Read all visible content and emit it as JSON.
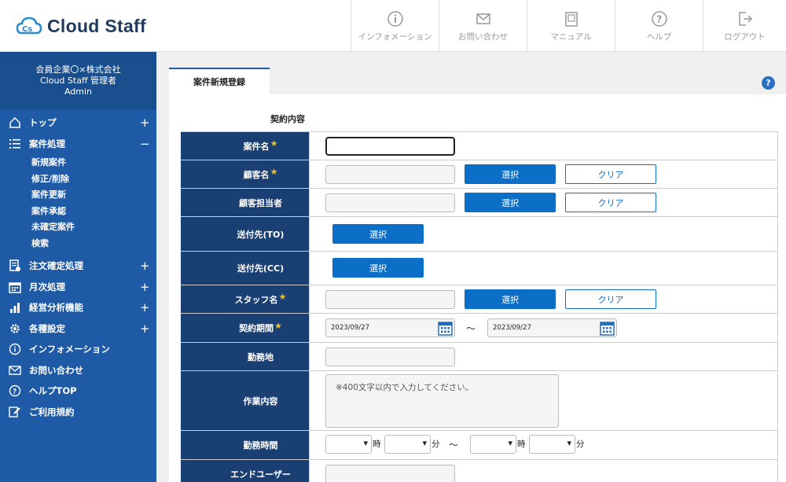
{
  "app": {
    "logo_text": "Cloud Staff",
    "brand_color": "#1e5aa6"
  },
  "header_nav": [
    {
      "label": "インフォメーション",
      "icon": "info-icon"
    },
    {
      "label": "お問い合わせ",
      "icon": "mail-icon"
    },
    {
      "label": "マニュアル",
      "icon": "manual-icon"
    },
    {
      "label": "ヘルプ",
      "icon": "help-icon"
    },
    {
      "label": "ログアウト",
      "icon": "logout-icon"
    }
  ],
  "sidebar": {
    "company_line1": "会員企業〇×株式会社",
    "company_line2": "Cloud Staff 管理者",
    "company_line3": "Admin",
    "menu": [
      {
        "label": "トップ",
        "icon": "home-icon",
        "toggle": "+"
      },
      {
        "label": "案件処理",
        "icon": "list-icon",
        "toggle": "−"
      },
      {
        "label": "注文確定処理",
        "icon": "document-icon",
        "toggle": "+"
      },
      {
        "label": "月次処理",
        "icon": "calendar-icon",
        "toggle": "+"
      },
      {
        "label": "経営分析機能",
        "icon": "chart-icon",
        "toggle": "+"
      },
      {
        "label": "各種設定",
        "icon": "gear-icon",
        "toggle": "+"
      },
      {
        "label": "インフォメーション",
        "icon": "info-icon",
        "toggle": ""
      },
      {
        "label": "お問い合わせ",
        "icon": "mail-icon",
        "toggle": ""
      },
      {
        "label": "ヘルプTOP",
        "icon": "help-icon",
        "toggle": ""
      },
      {
        "label": "ご利用規約",
        "icon": "edit-icon",
        "toggle": ""
      }
    ],
    "submenu": [
      "新規案件",
      "修正/削除",
      "案件更新",
      "案件承認",
      "未確定案件",
      "検索"
    ]
  },
  "main": {
    "tab_label": "案件新規登録",
    "section_label": "契約内容",
    "help_glyph": "?"
  },
  "form": {
    "required_mark": "★",
    "select_label": "選択",
    "clear_label": "クリア",
    "tilde": "〜",
    "rows": {
      "case_name": "案件名",
      "client_name": "顧客名",
      "client_contact": "顧客担当者",
      "send_to": "送付先(TO)",
      "send_cc": "送付先(CC)",
      "staff_name": "スタッフ名",
      "contract_period": "契約期間",
      "work_location": "勤務地",
      "work_content": "作業内容",
      "work_hours": "勤務時間",
      "end_user": "エンドユーザー"
    },
    "contract_start": "2023/09/27",
    "contract_end": "2023/09/27",
    "work_content_placeholder": "※400文字以内で入力してください。",
    "hour_unit": "時",
    "minute_unit": "分"
  }
}
